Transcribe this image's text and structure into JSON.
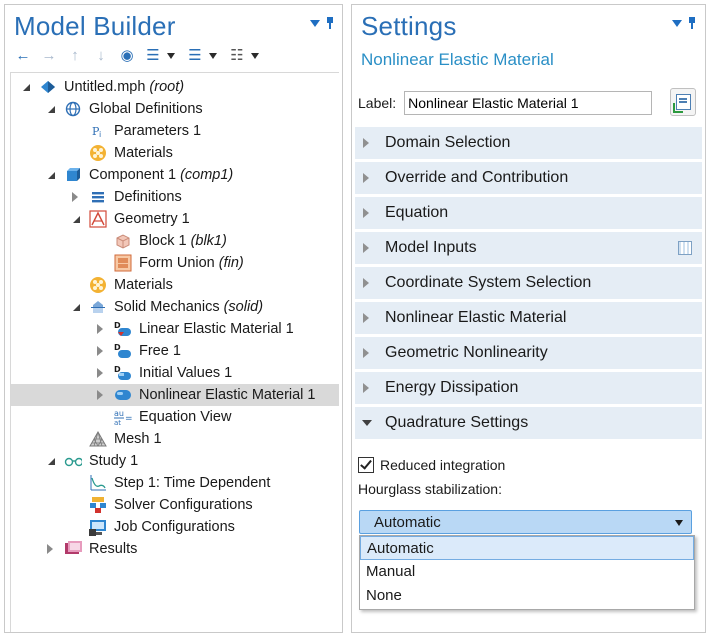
{
  "model_builder": {
    "title": "Model Builder",
    "tree": [
      {
        "label": "Untitled.mph",
        "tag": "(root)",
        "level": 0,
        "expander": "open",
        "icon": "model-icon"
      },
      {
        "label": "Global Definitions",
        "tag": "",
        "level": 1,
        "expander": "open",
        "icon": "globe-icon"
      },
      {
        "label": "Parameters 1",
        "tag": "",
        "level": 2,
        "expander": "none",
        "icon": "parameters-icon"
      },
      {
        "label": "Materials",
        "tag": "",
        "level": 2,
        "expander": "none",
        "icon": "materials-icon"
      },
      {
        "label": "Component 1",
        "tag": "(comp1)",
        "level": 1,
        "expander": "open",
        "icon": "component-icon"
      },
      {
        "label": "Definitions",
        "tag": "",
        "level": 2,
        "expander": "closed",
        "icon": "definitions-icon"
      },
      {
        "label": "Geometry 1",
        "tag": "",
        "level": 2,
        "expander": "open",
        "icon": "geometry-icon"
      },
      {
        "label": "Block 1",
        "tag": "(blk1)",
        "level": 3,
        "expander": "none",
        "icon": "block-icon"
      },
      {
        "label": "Form Union",
        "tag": "(fin)",
        "level": 3,
        "expander": "none",
        "icon": "form-union-icon"
      },
      {
        "label": "Materials",
        "tag": "",
        "level": 2,
        "expander": "none",
        "icon": "materials-icon"
      },
      {
        "label": "Solid Mechanics",
        "tag": "(solid)",
        "level": 2,
        "expander": "open",
        "icon": "solid-mechanics-icon"
      },
      {
        "label": "Linear Elastic Material 1",
        "tag": "",
        "level": 3,
        "expander": "closed",
        "icon": "linear-elastic-icon"
      },
      {
        "label": "Free 1",
        "tag": "",
        "level": 3,
        "expander": "closed",
        "icon": "free-icon"
      },
      {
        "label": "Initial Values 1",
        "tag": "",
        "level": 3,
        "expander": "closed",
        "icon": "initial-values-icon"
      },
      {
        "label": "Nonlinear Elastic Material 1",
        "tag": "",
        "level": 3,
        "expander": "closed",
        "icon": "nonlinear-elastic-icon",
        "selected": true
      },
      {
        "label": "Equation View",
        "tag": "",
        "level": 3,
        "expander": "none",
        "icon": "equation-view-icon"
      },
      {
        "label": "Mesh 1",
        "tag": "",
        "level": 2,
        "expander": "none",
        "icon": "mesh-icon"
      },
      {
        "label": "Study 1",
        "tag": "",
        "level": 1,
        "expander": "open",
        "icon": "study-icon"
      },
      {
        "label": "Step 1: Time Dependent",
        "tag": "",
        "level": 2,
        "expander": "none",
        "icon": "time-dependent-icon"
      },
      {
        "label": "Solver Configurations",
        "tag": "",
        "level": 2,
        "expander": "none",
        "icon": "solver-config-icon"
      },
      {
        "label": "Job Configurations",
        "tag": "",
        "level": 2,
        "expander": "none",
        "icon": "job-config-icon"
      },
      {
        "label": "Results",
        "tag": "",
        "level": 1,
        "expander": "closed",
        "icon": "results-icon"
      }
    ]
  },
  "settings": {
    "title": "Settings",
    "subtitle": "Nonlinear Elastic Material",
    "label_caption": "Label:",
    "label_value": "Nonlinear Elastic Material 1",
    "sections": [
      {
        "label": "Domain Selection",
        "expanded": false
      },
      {
        "label": "Override and Contribution",
        "expanded": false
      },
      {
        "label": "Equation",
        "expanded": false
      },
      {
        "label": "Model Inputs",
        "expanded": false
      },
      {
        "label": "Coordinate System Selection",
        "expanded": false
      },
      {
        "label": "Nonlinear Elastic Material",
        "expanded": false
      },
      {
        "label": "Geometric Nonlinearity",
        "expanded": false
      },
      {
        "label": "Energy Dissipation",
        "expanded": false
      },
      {
        "label": "Quadrature Settings",
        "expanded": true
      }
    ],
    "quadrature": {
      "reduced_integration_label": "Reduced integration",
      "reduced_integration_checked": true,
      "hourglass_label": "Hourglass stabilization:",
      "hourglass_selected": "Automatic",
      "hourglass_options": [
        "Automatic",
        "Manual",
        "None"
      ]
    }
  },
  "colors": {
    "title": "#2a6fb6",
    "section_bg": "#e5edf5",
    "select_bg": "#b9d8f5"
  }
}
